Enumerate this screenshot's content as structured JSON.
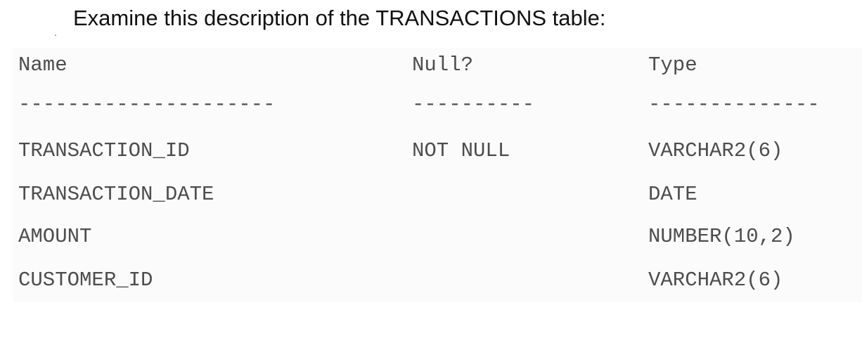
{
  "heading": "Examine this description of the TRANSACTIONS table:",
  "bullet": ".",
  "table": {
    "columns": [
      "Name",
      "Null?",
      "Type"
    ],
    "separators": [
      "---------------------",
      "----------",
      "--------------"
    ],
    "rows": [
      [
        "TRANSACTION_ID",
        "NOT NULL",
        "VARCHAR2(6)"
      ],
      [
        "TRANSACTION_DATE",
        "",
        "DATE"
      ],
      [
        "AMOUNT",
        "",
        "NUMBER(10,2)"
      ],
      [
        "CUSTOMER_ID",
        "",
        "VARCHAR2(6)"
      ]
    ]
  },
  "colors": {
    "panel_background": "#fcfbfc",
    "text": "#4d4d4d",
    "heading_text": "#111111"
  }
}
